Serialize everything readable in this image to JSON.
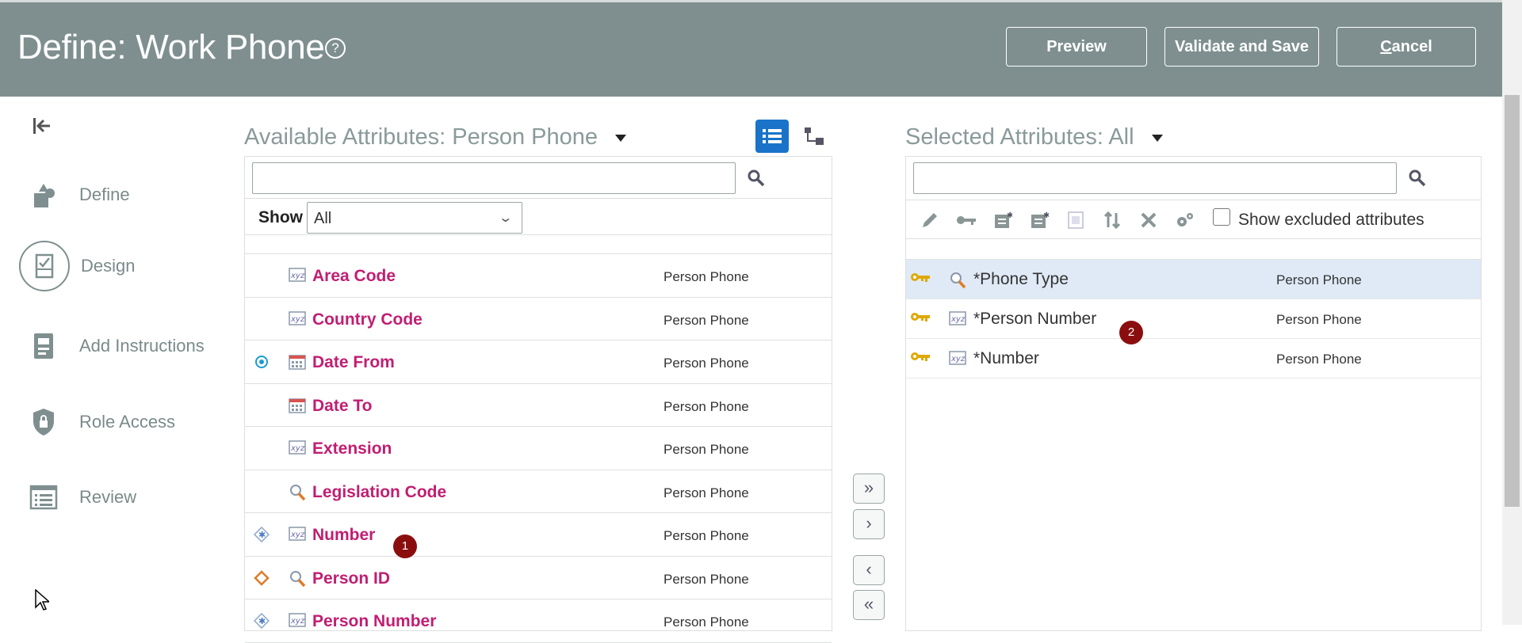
{
  "header": {
    "title": "Define: Work Phone",
    "help_icon": "?",
    "preview_label": "Preview",
    "validate_label": "Validate and Save",
    "cancel_label_first": "C",
    "cancel_label_rest": "ancel"
  },
  "nav": {
    "collapse_icon": "collapse-left-icon",
    "items": [
      {
        "label": "Define",
        "icon": "define-icon"
      },
      {
        "label": "Design",
        "icon": "design-icon"
      },
      {
        "label": "Add Instructions",
        "icon": "instructions-icon"
      },
      {
        "label": "Role Access",
        "icon": "shield-icon"
      },
      {
        "label": "Review",
        "icon": "review-list-icon"
      }
    ]
  },
  "available": {
    "title": "Available Attributes: Person Phone",
    "search_value": "",
    "show_label": "Show",
    "show_value": "All",
    "rows": [
      {
        "marker": "",
        "type": "text",
        "name": "Area Code",
        "object": "Person Phone"
      },
      {
        "marker": "",
        "type": "text",
        "name": "Country Code",
        "object": "Person Phone"
      },
      {
        "marker": "effective-date",
        "type": "date",
        "name": "Date From",
        "object": "Person Phone"
      },
      {
        "marker": "",
        "type": "date",
        "name": "Date To",
        "object": "Person Phone"
      },
      {
        "marker": "",
        "type": "text",
        "name": "Extension",
        "object": "Person Phone"
      },
      {
        "marker": "",
        "type": "lookup",
        "name": "Legislation Code",
        "object": "Person Phone"
      },
      {
        "marker": "required-blue",
        "type": "text",
        "name": "Number",
        "object": "Person Phone"
      },
      {
        "marker": "required-orange",
        "type": "lookup",
        "name": "Person ID",
        "object": "Person Phone"
      },
      {
        "marker": "required-blue",
        "type": "text",
        "name": "Person Number",
        "object": "Person Phone"
      }
    ]
  },
  "selected": {
    "title": "Selected Attributes: All",
    "search_value": "",
    "show_excluded_label": "Show excluded attributes",
    "show_excluded_checked": false,
    "rows": [
      {
        "type": "lookup",
        "name": "*Phone Type",
        "object": "Person Phone",
        "highlighted": true
      },
      {
        "type": "text",
        "name": "*Person Number",
        "object": "Person Phone",
        "highlighted": false
      },
      {
        "type": "text",
        "name": "*Number",
        "object": "Person Phone",
        "highlighted": false
      }
    ]
  },
  "shuttle": {
    "move_all_right": "»",
    "move_right": "›",
    "move_left": "‹",
    "move_all_left": "«"
  },
  "badges": {
    "one": "1",
    "two": "2"
  },
  "colors": {
    "header_bg": "#7f8f8f",
    "attr_name": "#c11e72",
    "accent_blue": "#1a73c9",
    "badge": "#8b0e0e",
    "key": "#e0a800"
  }
}
